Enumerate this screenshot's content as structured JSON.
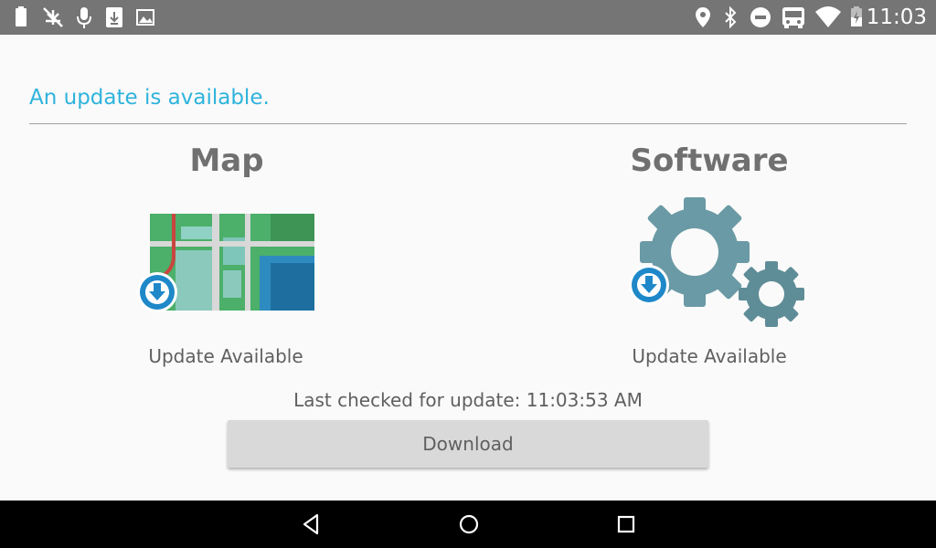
{
  "status_bar": {
    "time": "11:03",
    "left_icons": [
      "battery-icon",
      "no-network-icon",
      "microphone-icon",
      "download-notification-icon",
      "image-icon"
    ],
    "right_icons": [
      "location-icon",
      "bluetooth-icon",
      "do-not-disturb-icon",
      "bus-icon",
      "wifi-icon",
      "battery-charging-icon"
    ]
  },
  "main": {
    "headline": "An update is available.",
    "map": {
      "title": "Map",
      "status": "Update Available",
      "icon": "map-download-icon"
    },
    "software": {
      "title": "Software",
      "status": "Update Available",
      "icon": "gears-download-icon"
    },
    "last_checked": "Last checked for update: 11:03:53 AM",
    "download_label": "Download"
  },
  "nav_bar": {
    "buttons": [
      "back-icon",
      "home-icon",
      "recents-icon"
    ]
  },
  "colors": {
    "accent": "#2eb3dc",
    "status_bar": "#757575",
    "button": "#d9d9d9"
  }
}
